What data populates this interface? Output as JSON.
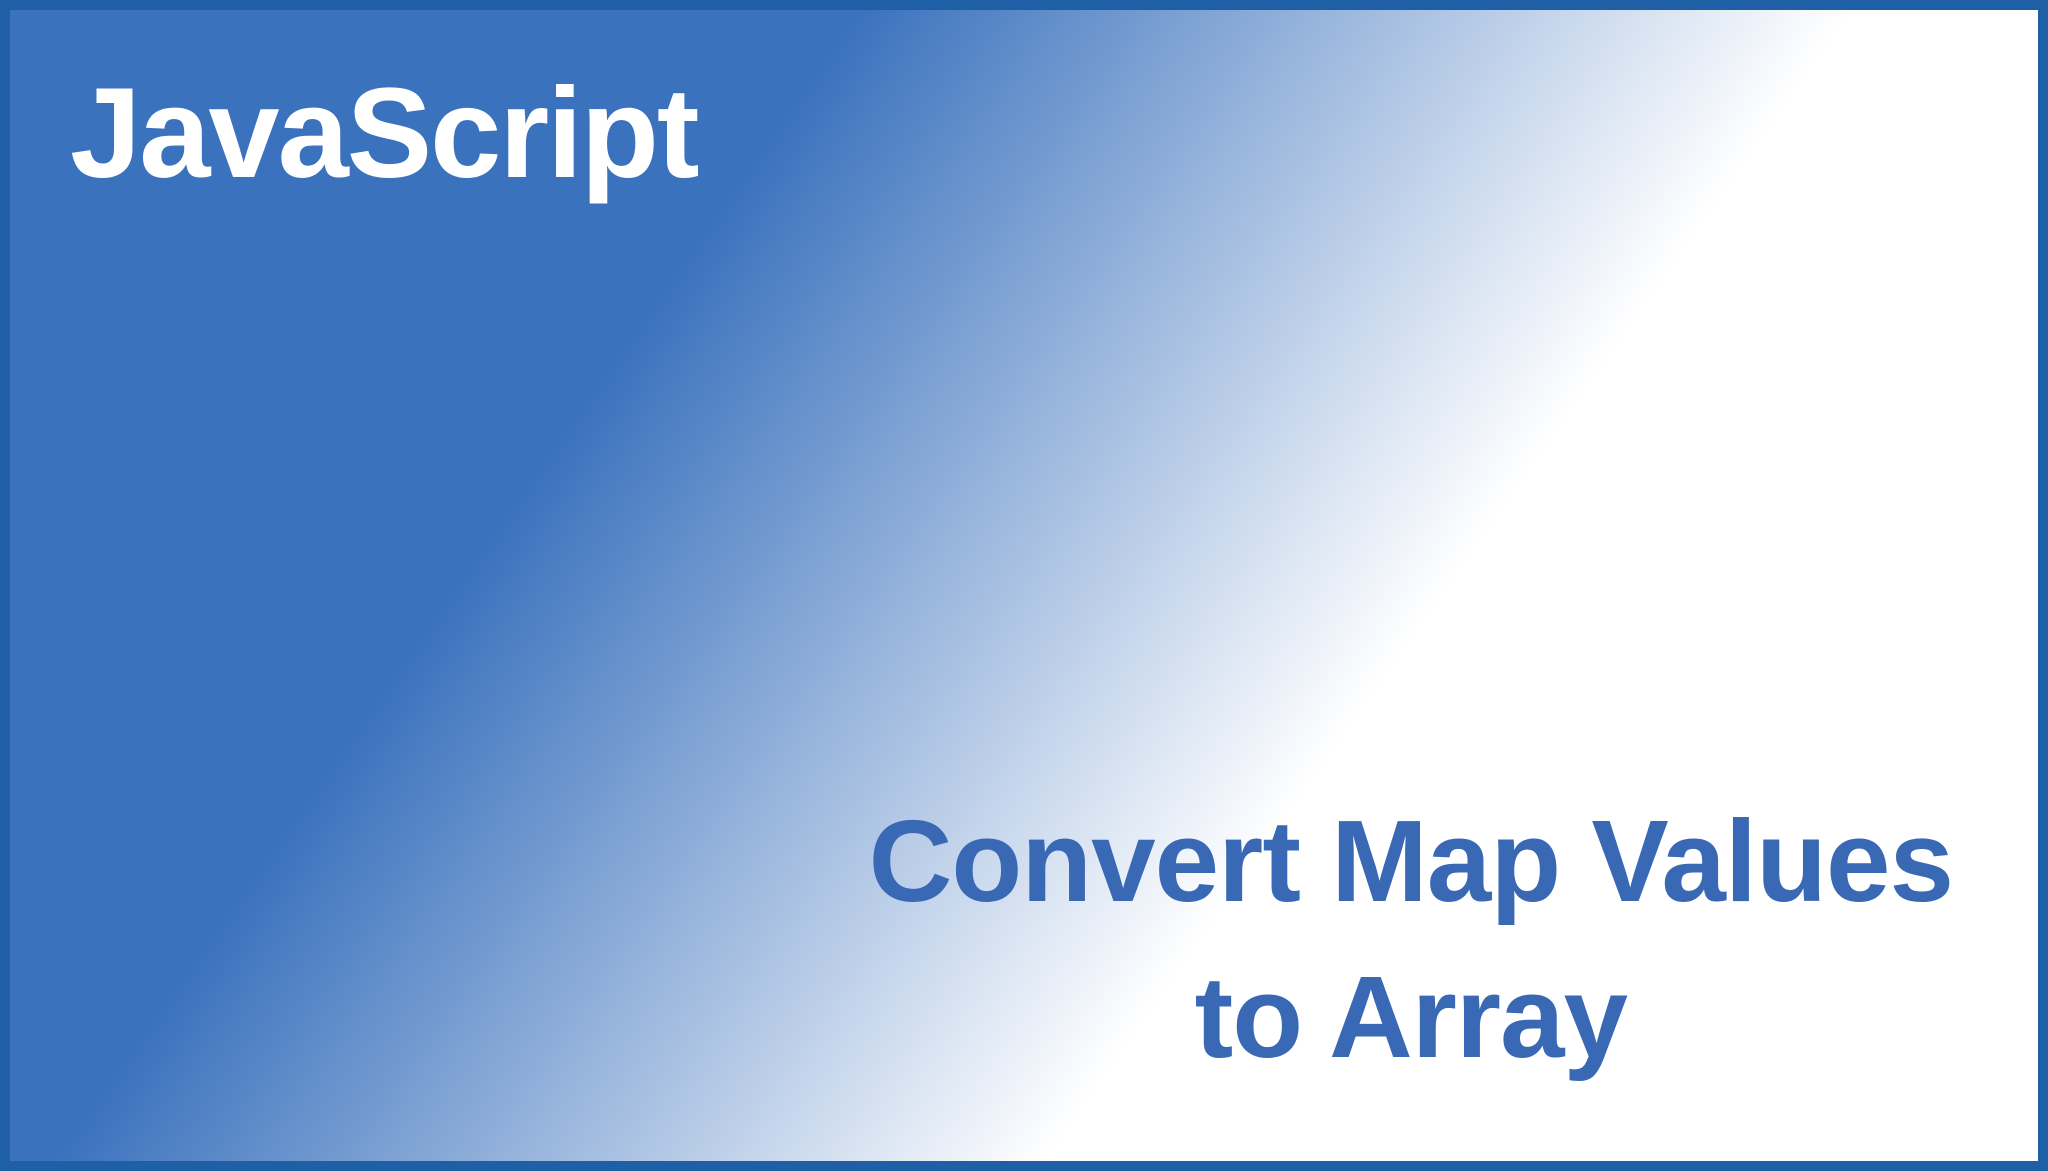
{
  "banner": {
    "title": "JavaScript",
    "subtitleLine1": "Convert Map Values",
    "subtitleLine2": "to Array",
    "colors": {
      "borderBlue": "#1e5fa6",
      "gradientBlue": "#3b72bd",
      "textBlue": "#3968b5",
      "titleWhite": "#ffffff"
    }
  }
}
